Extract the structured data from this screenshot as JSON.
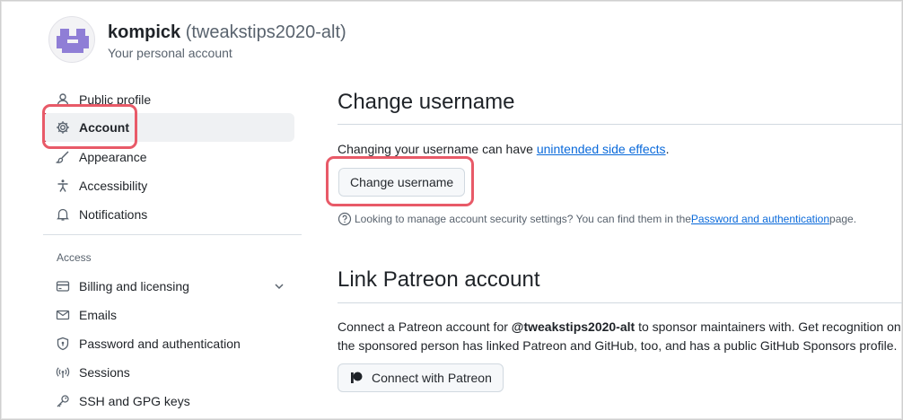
{
  "header": {
    "display_name": "kompick",
    "username": "(tweakstips2020-alt)",
    "subtitle": "Your personal account",
    "avatar_icon": "identicon-avatar"
  },
  "sidebar": {
    "items": [
      {
        "label": "Public profile",
        "icon": "person-icon"
      },
      {
        "label": "Account",
        "icon": "gear-icon",
        "active": true
      },
      {
        "label": "Appearance",
        "icon": "paintbrush-icon"
      },
      {
        "label": "Accessibility",
        "icon": "accessibility-icon"
      },
      {
        "label": "Notifications",
        "icon": "bell-icon"
      }
    ],
    "group_label": "Access",
    "access_items": [
      {
        "label": "Billing and licensing",
        "icon": "credit-card-icon",
        "expandable": true
      },
      {
        "label": "Emails",
        "icon": "mail-icon"
      },
      {
        "label": "Password and authentication",
        "icon": "shield-lock-icon"
      },
      {
        "label": "Sessions",
        "icon": "broadcast-icon"
      },
      {
        "label": "SSH and GPG keys",
        "icon": "key-icon"
      }
    ]
  },
  "change_username": {
    "heading": "Change username",
    "description_prefix": "Changing your username can have ",
    "description_link": "unintended side effects",
    "description_suffix": ".",
    "button_label": "Change username",
    "note_prefix": "Looking to manage account security settings? You can find them in the ",
    "note_link": "Password and authentication",
    "note_suffix": " page."
  },
  "patreon": {
    "heading": "Link Patreon account",
    "line1_prefix": "Connect a Patreon account for ",
    "line1_handle": "@tweakstips2020-alt",
    "line1_suffix": " to sponsor maintainers with. Get recognition on",
    "line2": "the sponsored person has linked Patreon and GitHub, too, and has a public GitHub Sponsors profile.",
    "button_label": "Connect with Patreon"
  },
  "colors": {
    "accent_bar": "#c51e3a",
    "highlight": "#e85a68",
    "link": "#0969da",
    "avatar": "#8f7ed6"
  }
}
